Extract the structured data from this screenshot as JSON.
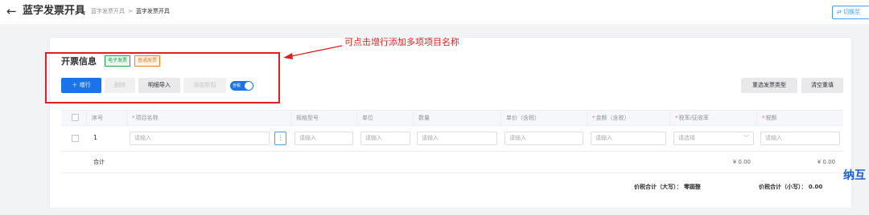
{
  "header": {
    "title": "蓝字发票开具",
    "breadcrumb": {
      "link": "蓝字发票开具",
      "separator": ">",
      "current": "蓝字发票开具"
    },
    "switch_label": "⇄ 切换至"
  },
  "annotation": {
    "text": "可点击增行添加多项项目名称"
  },
  "invoice": {
    "title": "开票信息",
    "tags": [
      "电子发票",
      "普通发票"
    ],
    "toolbar": {
      "add_row": "＋ 增行",
      "delete": "删除",
      "detail_import": "明细导入",
      "add_discount": "添加折扣",
      "tax_included_toggle": {
        "label": "含税",
        "on": true
      },
      "reselect_type": "重选发票类型",
      "clear_refill": "清空重填"
    },
    "table": {
      "columns": [
        {
          "label": "序号",
          "required": false
        },
        {
          "label": "项目名称",
          "required": true
        },
        {
          "label": "规格型号",
          "required": false
        },
        {
          "label": "单位",
          "required": false
        },
        {
          "label": "数量",
          "required": false
        },
        {
          "label": "单价（含税）",
          "required": false
        },
        {
          "label": "金额（含税）",
          "required": true
        },
        {
          "label": "税率/征收率",
          "required": true
        },
        {
          "label": "税额",
          "required": true
        }
      ],
      "rows": [
        {
          "no": "1",
          "item_name_placeholder": "请输入",
          "more": "⋮",
          "spec_placeholder": "请输入",
          "unit_placeholder": "请输入",
          "qty_placeholder": "请输入",
          "price_placeholder": "请输入",
          "amount_placeholder": "请输入",
          "tax_rate_placeholder": "请选择",
          "tax_amount_placeholder": "请输入"
        }
      ],
      "total": {
        "label": "合计",
        "amount": "¥ 0.00",
        "tax": "¥ 0.00"
      }
    },
    "summary": {
      "upper": "价税合计（大写）： 零圆整",
      "lower": "价税合计（小写）： 0.00"
    }
  },
  "decoration": {
    "chars": "纳互"
  },
  "colors": {
    "primary": "#1a73e8",
    "annotation": "#e02020",
    "required": "#f56c6c",
    "green_tag": "#1aa34a",
    "orange_tag": "#f08020"
  }
}
